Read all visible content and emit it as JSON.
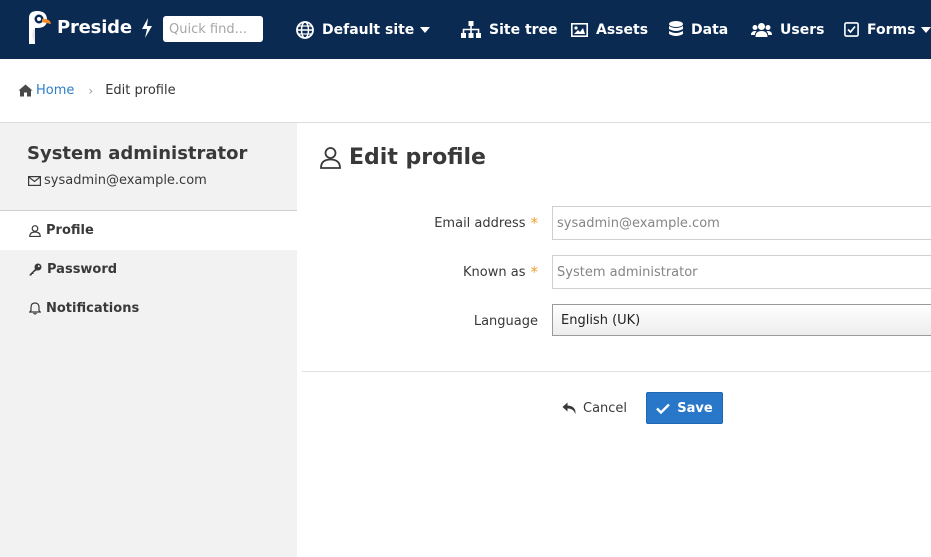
{
  "app": {
    "brand": "Preside"
  },
  "topbar": {
    "quick_find_placeholder": "Quick find...",
    "site_selector": "Default site",
    "nav": [
      {
        "label": "Site tree",
        "icon": "sitemap-icon"
      },
      {
        "label": "Assets",
        "icon": "image-icon"
      },
      {
        "label": "Data",
        "icon": "database-icon"
      },
      {
        "label": "Users",
        "icon": "users-icon"
      },
      {
        "label": "Forms",
        "icon": "check-square-icon"
      }
    ]
  },
  "breadcrumb": {
    "home": "Home",
    "current": "Edit profile"
  },
  "sidebar": {
    "user_name": "System administrator",
    "user_email": "sysadmin@example.com",
    "items": [
      {
        "label": "Profile",
        "icon": "user-icon",
        "active": true
      },
      {
        "label": "Password",
        "icon": "key-icon",
        "active": false
      },
      {
        "label": "Notifications",
        "icon": "bell-icon",
        "active": false
      }
    ]
  },
  "main": {
    "title": "Edit profile",
    "fields": {
      "email": {
        "label": "Email address",
        "placeholder": "sysadmin@example.com",
        "required": true
      },
      "known_as": {
        "label": "Known as",
        "placeholder": "System administrator",
        "required": true
      },
      "language": {
        "label": "Language",
        "value": "English (UK)"
      }
    },
    "required_marker": "*",
    "cancel_label": "Cancel",
    "save_label": "Save"
  },
  "colors": {
    "topbar": "#0a2a52",
    "accent": "#2977c9",
    "required": "#f0a02f",
    "link": "#2e7ec7"
  }
}
